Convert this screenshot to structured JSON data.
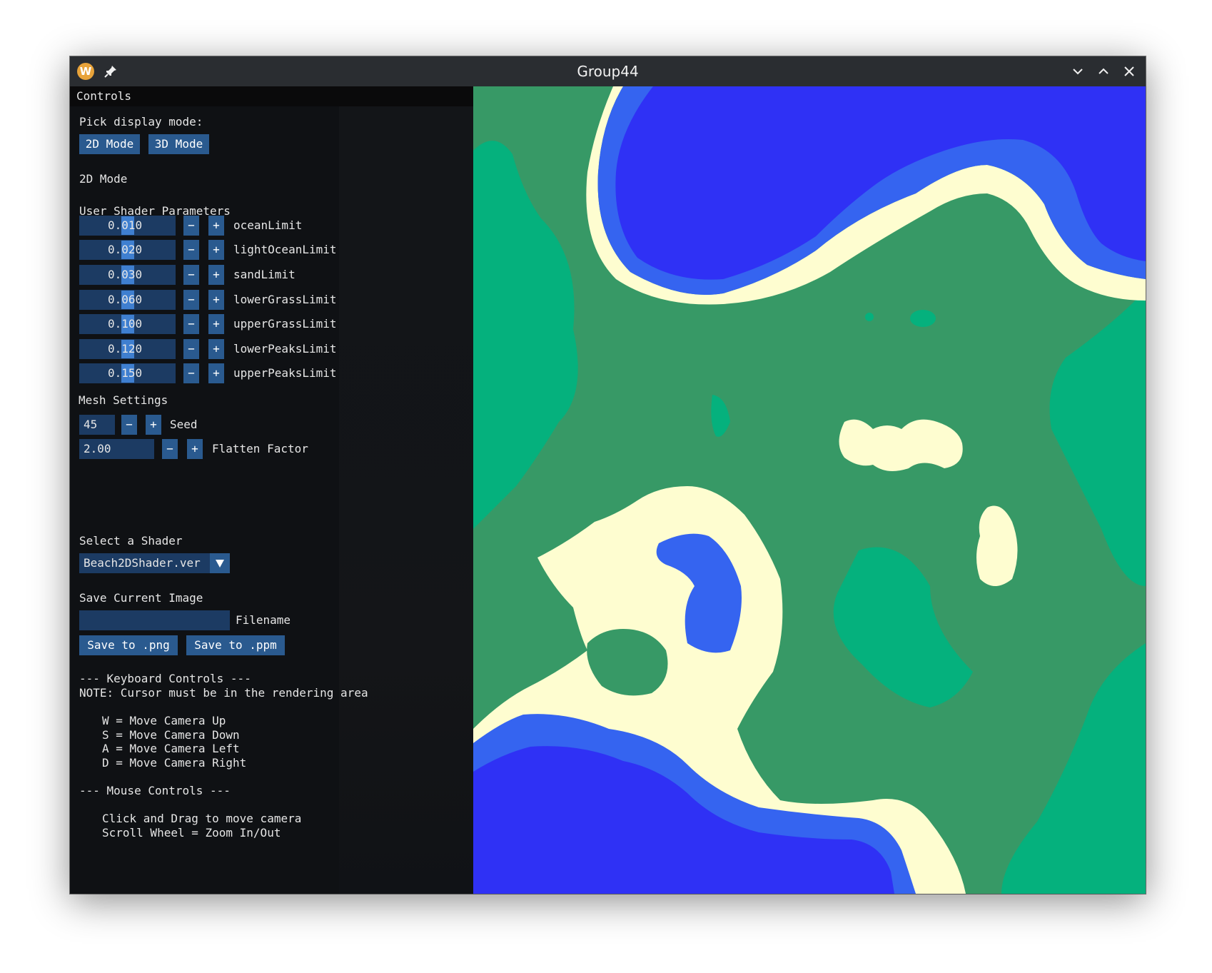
{
  "window": {
    "title": "Group44",
    "app_icon_letter": "W"
  },
  "controls": {
    "header": "Controls",
    "display_mode_label": "Pick display mode:",
    "mode_2d_button": "2D Mode",
    "mode_3d_button": "3D Mode",
    "current_mode": "2D Mode",
    "shader_params_heading": "User Shader Parameters",
    "shader_params": [
      {
        "name": "oceanLimit",
        "value": "0.010"
      },
      {
        "name": "lightOceanLimit",
        "value": "0.020"
      },
      {
        "name": "sandLimit",
        "value": "0.030"
      },
      {
        "name": "lowerGrassLimit",
        "value": "0.060"
      },
      {
        "name": "upperGrassLimit",
        "value": "0.100"
      },
      {
        "name": "lowerPeaksLimit",
        "value": "0.120"
      },
      {
        "name": "upperPeaksLimit",
        "value": "0.150"
      }
    ],
    "minus": "−",
    "plus": "+",
    "mesh_heading": "Mesh Settings",
    "seed": {
      "label": "Seed",
      "value": "45"
    },
    "flatten": {
      "label": "Flatten Factor",
      "value": "2.00"
    },
    "shader_select_label": "Select a Shader",
    "shader_select_value": "Beach2DShader.ver",
    "save_heading": "Save Current Image",
    "filename_label": "Filename",
    "filename_value": "",
    "save_png": "Save to .png",
    "save_ppm": "Save to .ppm",
    "keyboard_heading": "--- Keyboard Controls ---",
    "keyboard_note": "NOTE: Cursor must be in the rendering area",
    "keyboard_lines": [
      "W = Move Camera Up",
      "S = Move Camera Down",
      "A = Move Camera Left",
      "D = Move Camera Right"
    ],
    "mouse_heading": "--- Mouse Controls ---",
    "mouse_lines": [
      "Click and Drag to move camera",
      "Scroll Wheel = Zoom In/Out"
    ]
  },
  "map_colors": {
    "ocean": "#2f31f5",
    "light_ocean": "#3564f0",
    "sand": "#fefdd0",
    "lower_grass": "#379966",
    "upper_grass": "#05b17d"
  }
}
